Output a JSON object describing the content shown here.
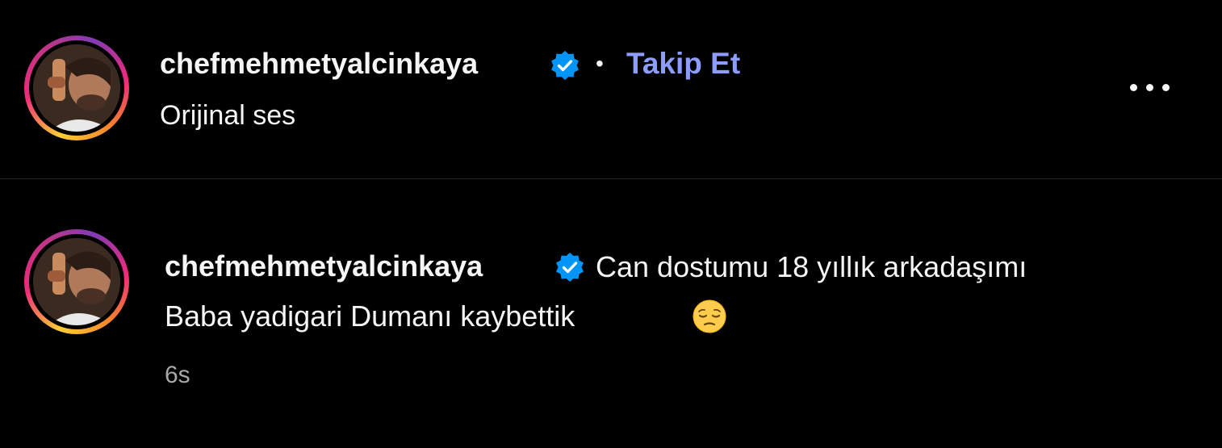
{
  "header": {
    "username": "chefmehmetyalcinkaya",
    "separator": "•",
    "follow_label": "Takip Et",
    "audio_label": "Orijinal ses",
    "more_icon": "more-horizontal-icon"
  },
  "caption": {
    "username": "chefmehmetyalcinkaya",
    "text_line1": "Can dostumu 18 yıllık arkadaşımı",
    "text_line2": "Baba yadigari Dumanı kaybettik",
    "emoji_icon": "pensive-face-emoji",
    "timestamp": "6s"
  },
  "colors": {
    "background": "#000000",
    "text": "#f5f5f5",
    "follow_link": "#8c9dff",
    "verified_badge": "#0095f6",
    "muted": "#a8a8a8",
    "divider": "#262626"
  }
}
